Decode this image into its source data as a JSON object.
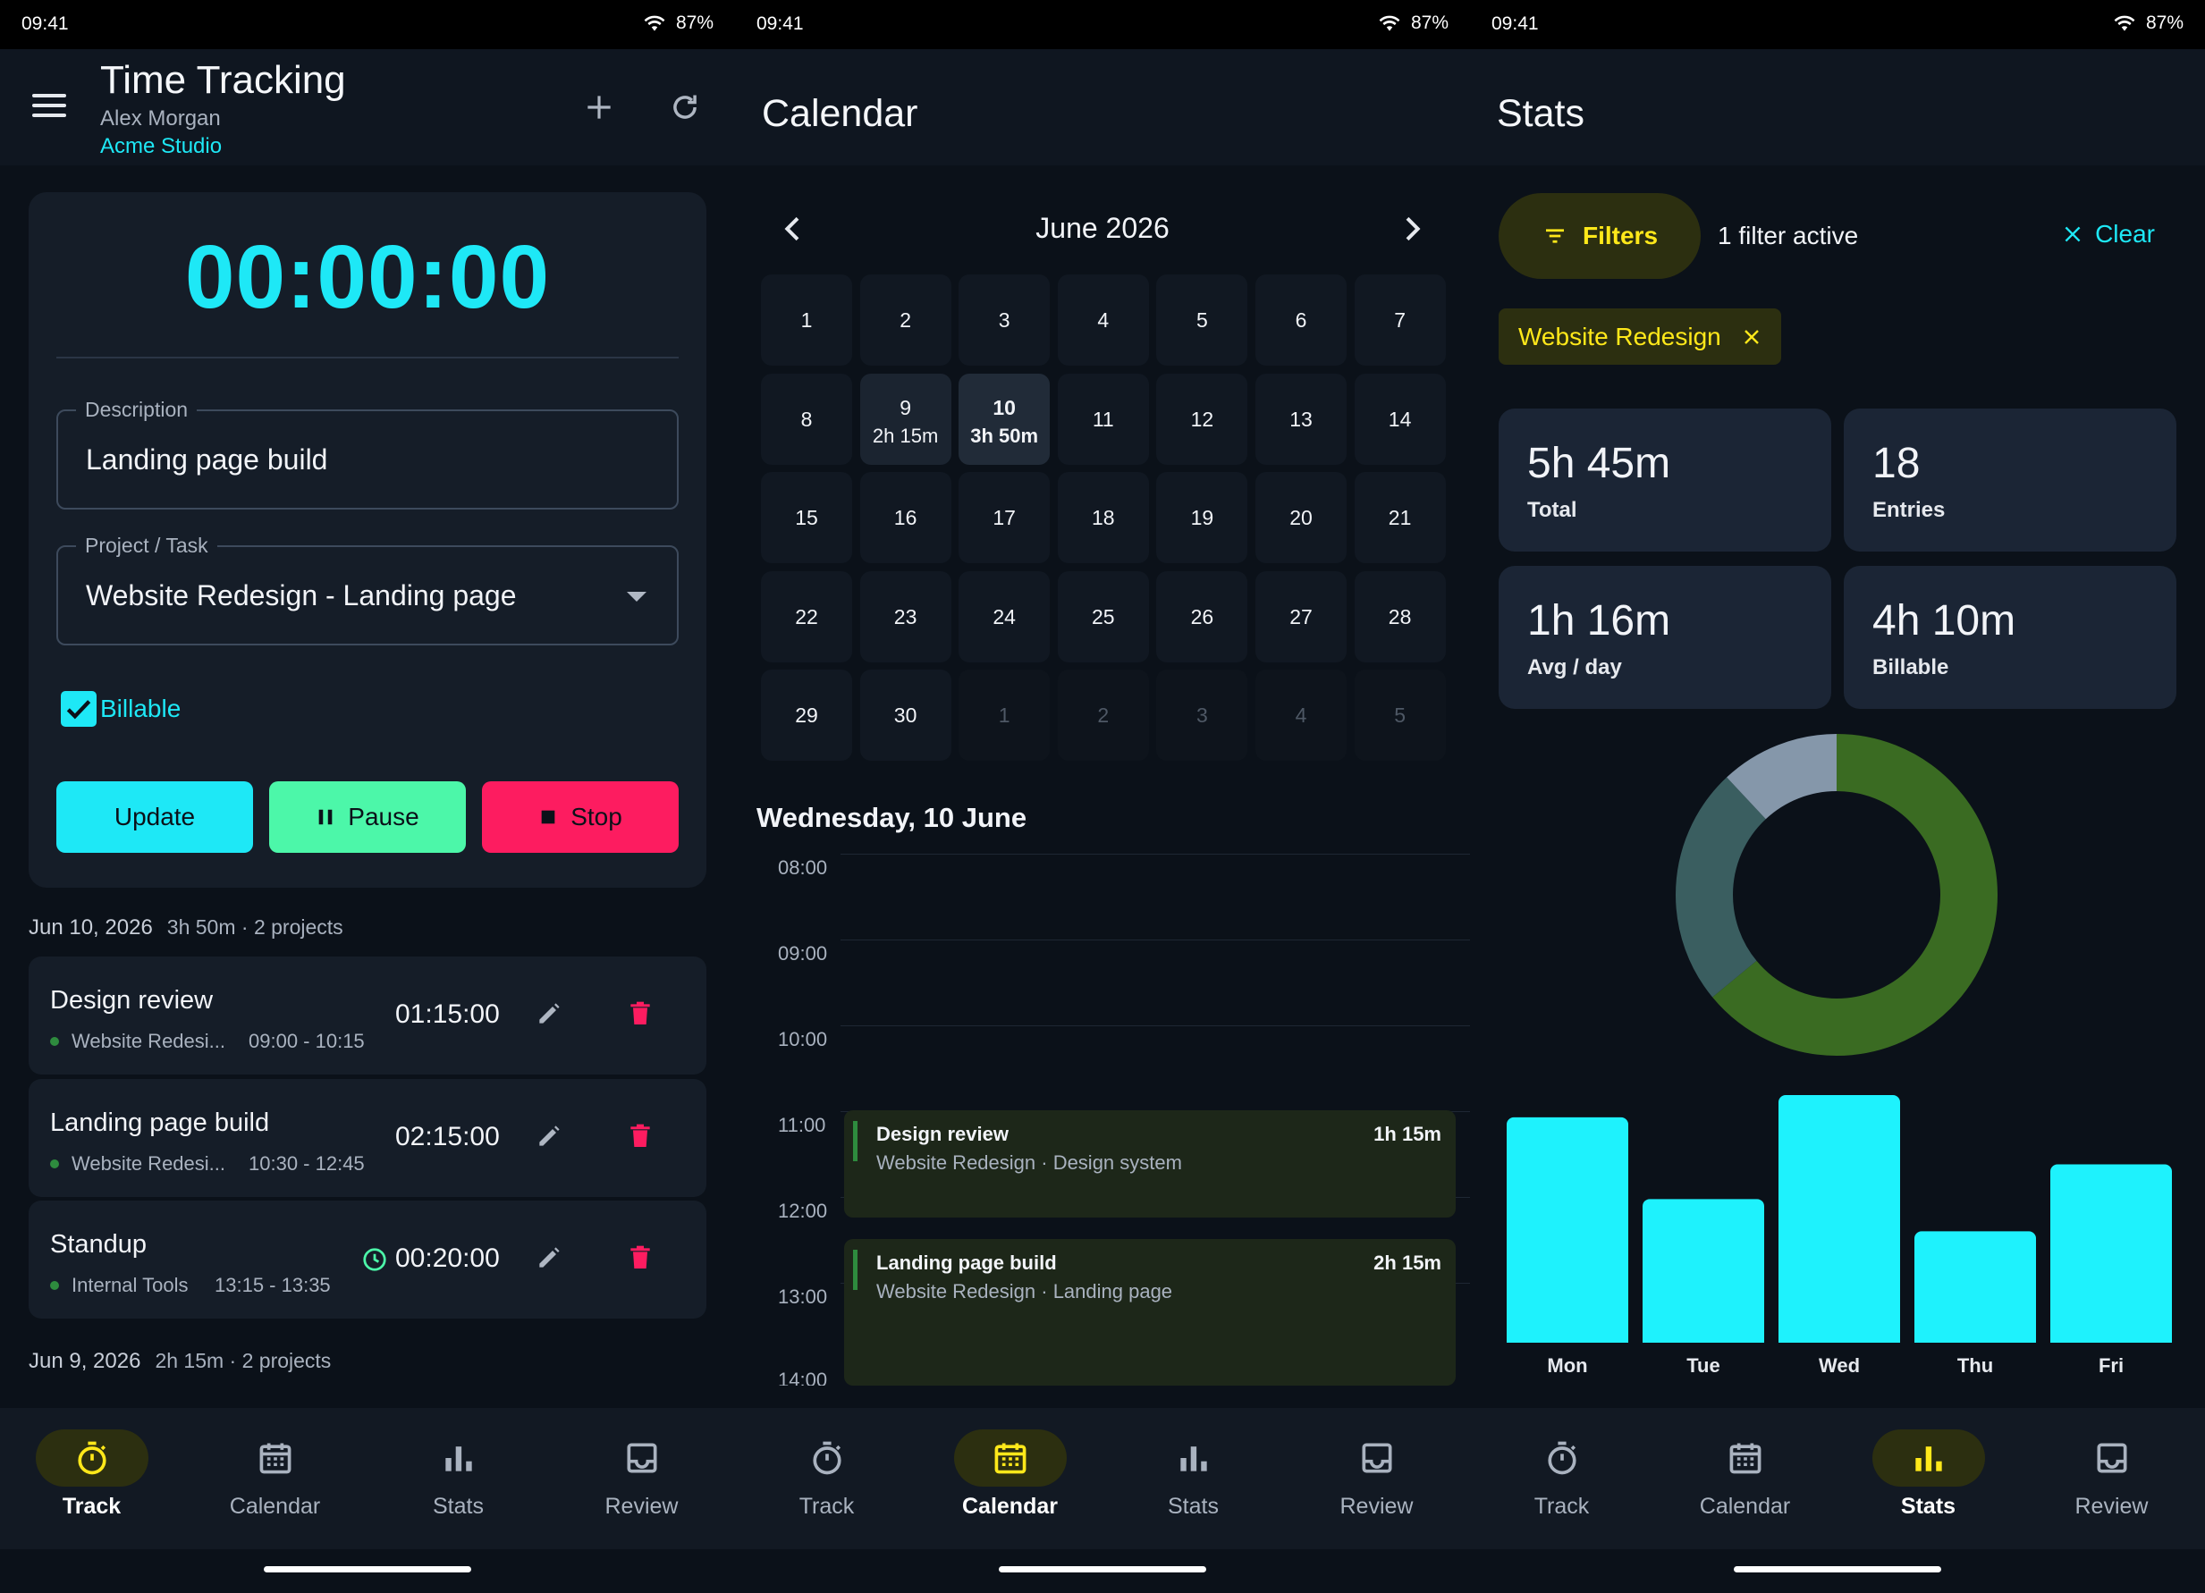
{
  "status": {
    "time": "09:41",
    "battery": "87%"
  },
  "nav": {
    "track": "Track",
    "calendar": "Calendar",
    "stats": "Stats",
    "review": "Review"
  },
  "track": {
    "title": "Time Tracking",
    "user": "Alex Morgan",
    "org": "Acme Studio",
    "timer": "00:00:00",
    "description_label": "Description",
    "description_value": "Landing page build",
    "project_label": "Project / Task",
    "project_value": "Website Redesign - Landing page",
    "billable_label": "Billable",
    "billable_checked": true,
    "buttons": {
      "update": "Update",
      "pause": "Pause",
      "stop": "Stop"
    },
    "days": [
      {
        "date": "Jun 10, 2026",
        "summary": "3h 50m · 2 projects",
        "entries": [
          {
            "title": "Design review",
            "project": "Website Redesi...",
            "range": "09:00 - 10:15",
            "duration": "01:15:00"
          },
          {
            "title": "Landing page build",
            "project": "Website Redesi...",
            "range": "10:30 - 12:45",
            "duration": "02:15:00"
          },
          {
            "title": "Standup",
            "project": "Internal Tools",
            "range": "13:15 - 13:35",
            "duration": "00:20:00"
          }
        ]
      },
      {
        "date": "Jun 9, 2026",
        "summary": "2h 15m · 2 projects"
      }
    ]
  },
  "calendar": {
    "title": "Calendar",
    "month": "June 2026",
    "days": [
      {
        "n": "1"
      },
      {
        "n": "2"
      },
      {
        "n": "3"
      },
      {
        "n": "4"
      },
      {
        "n": "5"
      },
      {
        "n": "6"
      },
      {
        "n": "7"
      },
      {
        "n": "8"
      },
      {
        "n": "9",
        "sub": "2h 15m"
      },
      {
        "n": "10",
        "sub": "3h 50m",
        "selected": true
      },
      {
        "n": "11"
      },
      {
        "n": "12"
      },
      {
        "n": "13"
      },
      {
        "n": "14"
      },
      {
        "n": "15"
      },
      {
        "n": "16"
      },
      {
        "n": "17"
      },
      {
        "n": "18"
      },
      {
        "n": "19"
      },
      {
        "n": "20"
      },
      {
        "n": "21"
      },
      {
        "n": "22"
      },
      {
        "n": "23"
      },
      {
        "n": "24"
      },
      {
        "n": "25"
      },
      {
        "n": "26"
      },
      {
        "n": "27"
      },
      {
        "n": "28"
      },
      {
        "n": "29"
      },
      {
        "n": "30"
      },
      {
        "n": "1",
        "outside": true
      },
      {
        "n": "2",
        "outside": true
      },
      {
        "n": "3",
        "outside": true
      },
      {
        "n": "4",
        "outside": true
      },
      {
        "n": "5",
        "outside": true
      }
    ],
    "selected_day": "Wednesday, 10 June",
    "hours": [
      "08:00",
      "09:00",
      "10:00",
      "11:00",
      "12:00",
      "13:00",
      "14:00"
    ],
    "events": [
      {
        "title": "Design review",
        "subtitle": "Website Redesign · Design system",
        "duration": "1h 15m"
      },
      {
        "title": "Landing page build",
        "subtitle": "Website Redesign · Landing page",
        "duration": "2h 15m"
      }
    ]
  },
  "stats": {
    "title": "Stats",
    "filters_label": "Filters",
    "filter_count": "1 filter active",
    "clear_label": "Clear",
    "chip": "Website Redesign",
    "summary": [
      {
        "value": "5h 45m",
        "label": "Total"
      },
      {
        "value": "18",
        "label": "Entries"
      },
      {
        "value": "1h 16m",
        "label": "Avg / day"
      },
      {
        "value": "4h 10m",
        "label": "Billable"
      }
    ]
  },
  "chart_data": [
    {
      "type": "pie",
      "slices": [
        {
          "value": 0.64,
          "color": "#3a6b22"
        },
        {
          "value": 0.24,
          "color": "#3a5e60"
        },
        {
          "value": 0.12,
          "color": "#8597aa"
        }
      ]
    },
    {
      "type": "bar",
      "categories": [
        "Mon",
        "Tue",
        "Wed",
        "Thu",
        "Fri"
      ],
      "values": [
        0.91,
        0.58,
        1.0,
        0.45,
        0.72
      ],
      "color": "#1ef2fd"
    }
  ],
  "colors": {
    "accent": "#1ee8f6",
    "pause": "#4cf7a9",
    "stop": "#fd1c60",
    "highlight": "#ffe81a"
  }
}
